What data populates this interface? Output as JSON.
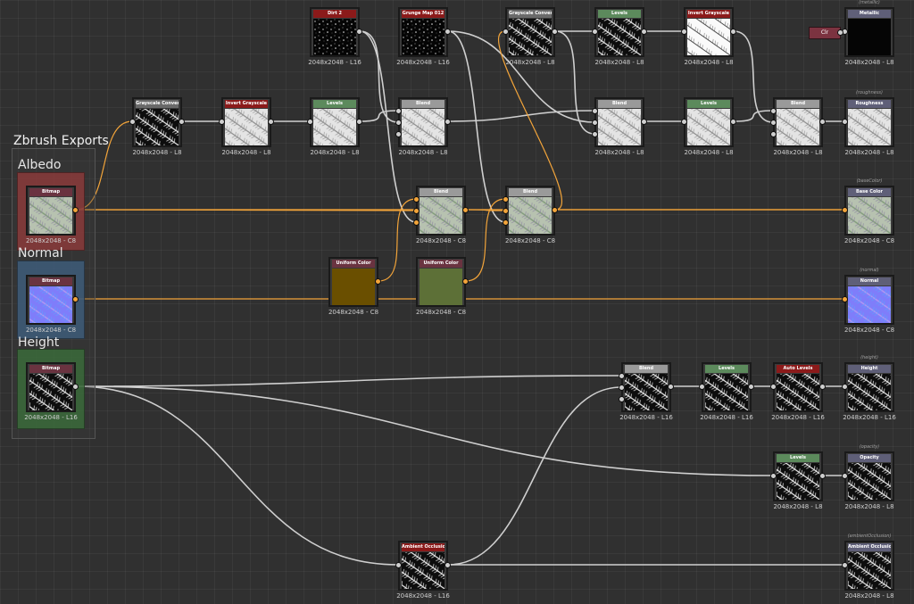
{
  "frame": {
    "title": "Zbrush Exports"
  },
  "groups": [
    {
      "id": "albedo",
      "title": "Albedo",
      "color": "#8a3a3a"
    },
    {
      "id": "normal",
      "title": "Normal",
      "color": "#3e5c7a"
    },
    {
      "id": "height",
      "title": "Height",
      "color": "#3b6b3b"
    }
  ],
  "colors": {
    "wire_gray": "#cfcfcf",
    "wire_orange": "#f2a43a",
    "head_red": "#8b1a1a",
    "head_gray": "#6a6a6a",
    "head_green": "#5c8a5c",
    "head_purple": "#6b6b84",
    "head_maroon": "#6a3340",
    "head_lightgray": "#9a9a9a",
    "head_output": "#5f5f78"
  },
  "mini_node": {
    "label": "Clr"
  },
  "nodes": [
    {
      "id": "grayconv1",
      "title": "Grayscale Convers...",
      "size": "2048x2048 - L8",
      "head": "head_gray",
      "thumb": "fern_dark"
    },
    {
      "id": "invert1",
      "title": "Invert Grayscale",
      "size": "2048x2048 - L8",
      "head": "head_red",
      "thumb": "fern_light"
    },
    {
      "id": "levels1",
      "title": "Levels",
      "size": "2048x2048 - L8",
      "head": "head_green",
      "thumb": "fern_light"
    },
    {
      "id": "dirt2",
      "title": "Dirt 2",
      "size": "2048x2048 - L16",
      "head": "head_red",
      "thumb": "noise"
    },
    {
      "id": "grunge",
      "title": "Grunge Map 012",
      "size": "2048x2048 - L16",
      "head": "head_red",
      "thumb": "noise"
    },
    {
      "id": "blend1",
      "title": "Blend",
      "size": "2048x2048 - L8",
      "head": "head_lightgray",
      "thumb": "fern_light"
    },
    {
      "id": "grayconv2",
      "title": "Grayscale Convers...",
      "size": "2048x2048 - L8",
      "head": "head_gray",
      "thumb": "fern_dark"
    },
    {
      "id": "levels2",
      "title": "Levels",
      "size": "2048x2048 - L8",
      "head": "head_green",
      "thumb": "fern_dark"
    },
    {
      "id": "invert2",
      "title": "Invert Grayscale",
      "size": "2048x2048 - L8",
      "head": "head_red",
      "thumb": "fern_white"
    },
    {
      "id": "blend2",
      "title": "Blend",
      "size": "2048x2048 - L8",
      "head": "head_lightgray",
      "thumb": "fern_light"
    },
    {
      "id": "levels3",
      "title": "Levels",
      "size": "2048x2048 - L8",
      "head": "head_green",
      "thumb": "fern_light"
    },
    {
      "id": "blend3",
      "title": "Blend",
      "size": "2048x2048 - L8",
      "head": "head_lightgray",
      "thumb": "fern_light"
    },
    {
      "id": "metallic",
      "title": "Metallic",
      "size": "2048x2048 - L8",
      "head": "head_output",
      "thumb": "black",
      "output": "(metallic)"
    },
    {
      "id": "roughness",
      "title": "Roughness",
      "size": "2048x2048 - L8",
      "head": "head_output",
      "thumb": "fern_light",
      "output": "(roughness)"
    },
    {
      "id": "bitmap_albedo",
      "title": "Bitmap",
      "size": "2048x2048 - C8",
      "head": "head_maroon",
      "thumb": "albedo"
    },
    {
      "id": "blendc1",
      "title": "Blend",
      "size": "2048x2048 - C8",
      "head": "head_lightgray",
      "thumb": "albedo"
    },
    {
      "id": "blendc2",
      "title": "Blend",
      "size": "2048x2048 - C8",
      "head": "head_lightgray",
      "thumb": "albedo"
    },
    {
      "id": "basecolor",
      "title": "Base Color",
      "size": "2048x2048 - C8",
      "head": "head_output",
      "thumb": "albedo",
      "output": "(baseColor)"
    },
    {
      "id": "uniform1",
      "title": "Uniform Color",
      "size": "2048x2048 - C8",
      "head": "head_maroon",
      "thumb": "brown"
    },
    {
      "id": "uniform2",
      "title": "Uniform Color",
      "size": "2048x2048 - C8",
      "head": "head_maroon",
      "thumb": "olive"
    },
    {
      "id": "bitmap_normal",
      "title": "Bitmap",
      "size": "2048x2048 - C8",
      "head": "head_maroon",
      "thumb": "normal"
    },
    {
      "id": "normal_out",
      "title": "Normal",
      "size": "2048x2048 - C8",
      "head": "head_output",
      "thumb": "normal",
      "output": "(normal)"
    },
    {
      "id": "bitmap_height",
      "title": "Bitmap",
      "size": "2048x2048 - L16",
      "head": "head_maroon",
      "thumb": "fern_dark"
    },
    {
      "id": "blendh",
      "title": "Blend",
      "size": "2048x2048 - L16",
      "head": "head_lightgray",
      "thumb": "fern_dark"
    },
    {
      "id": "levels4",
      "title": "Levels",
      "size": "2048x2048 - L16",
      "head": "head_green",
      "thumb": "fern_dark"
    },
    {
      "id": "autolevels",
      "title": "Auto Levels",
      "size": "2048x2048 - L16",
      "head": "head_red",
      "thumb": "fern_dark"
    },
    {
      "id": "height_out",
      "title": "Height",
      "size": "2048x2048 - L16",
      "head": "head_output",
      "thumb": "fern_dark",
      "output": "(height)"
    },
    {
      "id": "levels5",
      "title": "Levels",
      "size": "2048x2048 - L8",
      "head": "head_green",
      "thumb": "fern_dark"
    },
    {
      "id": "opacity",
      "title": "Opacity",
      "size": "2048x2048 - L8",
      "head": "head_output",
      "thumb": "fern_dark",
      "output": "(opacity)"
    },
    {
      "id": "ao",
      "title": "Ambient Occlusion...",
      "size": "2048x2048 - L16",
      "head": "head_red",
      "thumb": "fern_dark"
    },
    {
      "id": "ao_out",
      "title": "Ambient Occlusion",
      "size": "2048x2048 - L8",
      "head": "head_output",
      "thumb": "fern_dark",
      "output": "(ambientOcclusion)"
    }
  ],
  "connections": [
    {
      "from": "bitmap_albedo",
      "to": "grayconv1",
      "in": 0,
      "kind": "orange"
    },
    {
      "from": "grayconv1",
      "to": "invert1",
      "in": 0,
      "kind": "gray"
    },
    {
      "from": "invert1",
      "to": "levels1",
      "in": 0,
      "kind": "gray"
    },
    {
      "from": "levels1",
      "to": "blend1",
      "in": 0,
      "kind": "gray"
    },
    {
      "from": "dirt2",
      "to": "blend1",
      "in": 1,
      "kind": "gray"
    },
    {
      "from": "dirt2",
      "to": "blendc1",
      "in": 2,
      "kind": "gray"
    },
    {
      "from": "grunge",
      "to": "blend2",
      "in": 1,
      "kind": "gray"
    },
    {
      "from": "grunge",
      "to": "blendc2",
      "in": 2,
      "kind": "gray"
    },
    {
      "from": "blend1",
      "to": "blend2",
      "in": 0,
      "kind": "gray"
    },
    {
      "from": "grayconv2",
      "to": "levels2",
      "in": 0,
      "kind": "gray"
    },
    {
      "from": "grayconv2",
      "to": "blend2",
      "in": 2,
      "kind": "gray"
    },
    {
      "from": "levels2",
      "to": "invert2",
      "in": 0,
      "kind": "gray"
    },
    {
      "from": "invert2",
      "to": "blend3",
      "in": 1,
      "kind": "gray"
    },
    {
      "from": "blend2",
      "to": "levels3",
      "in": 0,
      "kind": "gray"
    },
    {
      "from": "levels3",
      "to": "blend3",
      "in": 0,
      "kind": "gray"
    },
    {
      "from": "blend3",
      "to": "roughness",
      "in": 0,
      "kind": "gray"
    },
    {
      "from": "bitmap_albedo",
      "to": "blendc1",
      "in": 1,
      "kind": "orange"
    },
    {
      "from": "bitmap_albedo",
      "to": "basecolor",
      "in": 0,
      "kind": "orange"
    },
    {
      "from": "blendc1",
      "to": "blendc2",
      "in": 1,
      "kind": "orange"
    },
    {
      "from": "blendc2",
      "to": "grayconv2",
      "in": 0,
      "kind": "orange"
    },
    {
      "from": "blendc2",
      "to": "basecolor",
      "in": 0,
      "kind": "orange"
    },
    {
      "from": "uniform1",
      "to": "blendc1",
      "in": 0,
      "kind": "orange"
    },
    {
      "from": "uniform2",
      "to": "blendc2",
      "in": 0,
      "kind": "orange"
    },
    {
      "from": "bitmap_normal",
      "to": "normal_out",
      "in": 0,
      "kind": "orange"
    },
    {
      "from": "bitmap_height",
      "to": "blendh",
      "in": 0,
      "kind": "gray"
    },
    {
      "from": "bitmap_height",
      "to": "levels5",
      "in": 0,
      "kind": "gray"
    },
    {
      "from": "bitmap_height",
      "to": "ao",
      "in": 0,
      "kind": "gray"
    },
    {
      "from": "blendh",
      "to": "levels4",
      "in": 0,
      "kind": "gray"
    },
    {
      "from": "levels4",
      "to": "autolevels",
      "in": 0,
      "kind": "gray"
    },
    {
      "from": "autolevels",
      "to": "height_out",
      "in": 0,
      "kind": "gray"
    },
    {
      "from": "levels5",
      "to": "opacity",
      "in": 0,
      "kind": "gray"
    },
    {
      "from": "ao",
      "to": "ao_out",
      "in": 0,
      "kind": "gray"
    },
    {
      "from": "ao",
      "to": "blendh",
      "in": 1,
      "kind": "gray"
    }
  ]
}
